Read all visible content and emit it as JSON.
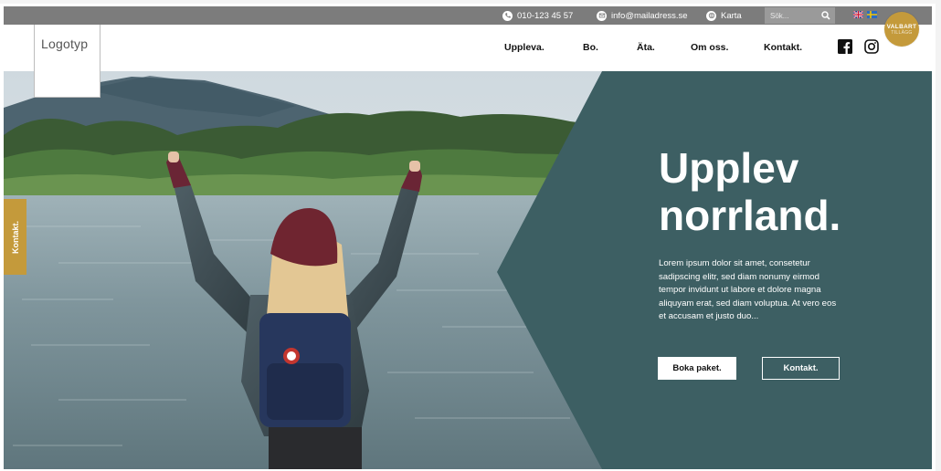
{
  "topbar": {
    "phone": "010-123 45 57",
    "email": "info@mailadress.se",
    "map_label": "Karta",
    "search_placeholder": "Sök..."
  },
  "header": {
    "logo": "Logotyp",
    "nav": [
      "Uppleva.",
      "Bo.",
      "Äta.",
      "Om oss.",
      "Kontakt."
    ],
    "badge_line1": "VALBART",
    "badge_line2": "TILLÄGG"
  },
  "hero": {
    "headline_line1": "Upplev",
    "headline_line2": "norrland.",
    "body": "Lorem ipsum dolor sit amet, consetetur sadipscing elitr, sed diam nonumy eirmod tempor invidunt ut labore et dolore magna aliquyam erat, sed diam voluptua. At vero eos et accusam et justo duo...",
    "primary_button": "Boka paket.",
    "secondary_button": "Kontakt."
  },
  "side_tab": "Kontakt.",
  "icons": {
    "phone": "phone-icon",
    "email": "email-icon",
    "map": "globe-icon",
    "search": "search-icon",
    "flag_uk": "uk-flag-icon",
    "flag_se": "sweden-flag-icon",
    "facebook": "facebook-icon",
    "instagram": "instagram-icon"
  },
  "colors": {
    "topbar": "#7c7c7c",
    "teal_panel": "#3d5f63",
    "accent_gold": "#c49a3b"
  }
}
